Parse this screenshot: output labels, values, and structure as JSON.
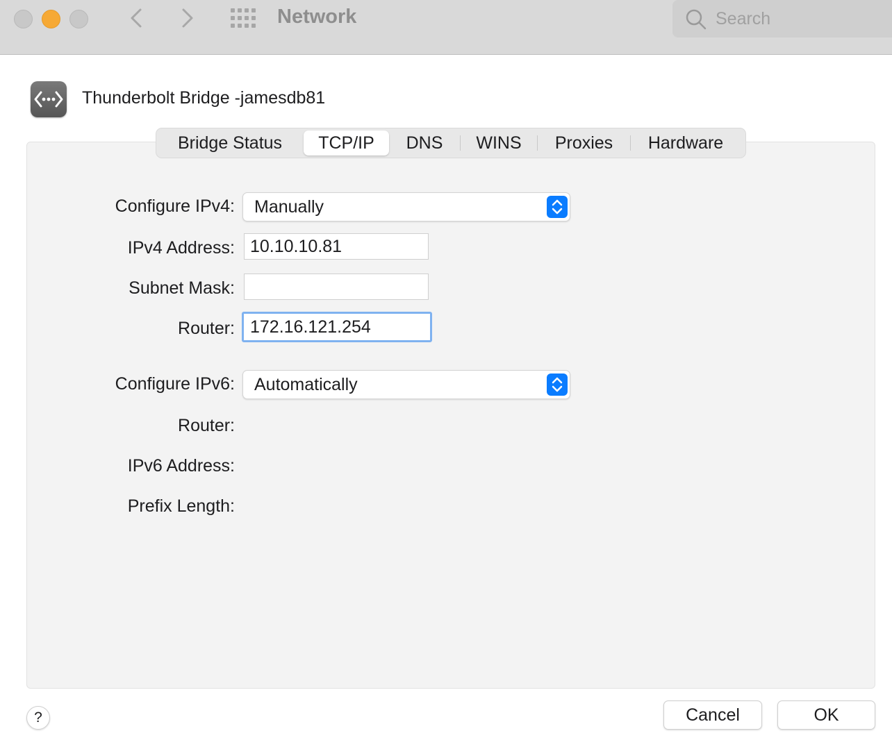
{
  "window": {
    "title": "Network",
    "search": {
      "placeholder": "Search"
    }
  },
  "service": {
    "name": "Thunderbolt Bridge -jamesdb81",
    "icon": "network-bridge-icon"
  },
  "tabs": [
    {
      "label": "Bridge Status",
      "selected": false
    },
    {
      "label": "TCP/IP",
      "selected": true
    },
    {
      "label": "DNS",
      "selected": false
    },
    {
      "label": "WINS",
      "selected": false
    },
    {
      "label": "Proxies",
      "selected": false
    },
    {
      "label": "Hardware",
      "selected": false
    }
  ],
  "ipv4": {
    "configure_label": "Configure IPv4:",
    "configure_value": "Manually",
    "address_label": "IPv4 Address:",
    "address_value": "10.10.10.81",
    "subnet_label": "Subnet Mask:",
    "subnet_value": "",
    "router_label": "Router:",
    "router_value": "172.16.121.254"
  },
  "ipv6": {
    "configure_label": "Configure IPv6:",
    "configure_value": "Automatically",
    "router_label": "Router:",
    "address_label": "IPv6 Address:",
    "prefix_label": "Prefix Length:"
  },
  "buttons": {
    "help": "?",
    "cancel": "Cancel",
    "ok": "OK"
  },
  "colors": {
    "accent": "#0a7cff",
    "focus_ring": "#7fb2f0",
    "minimize": "#f6a935"
  }
}
